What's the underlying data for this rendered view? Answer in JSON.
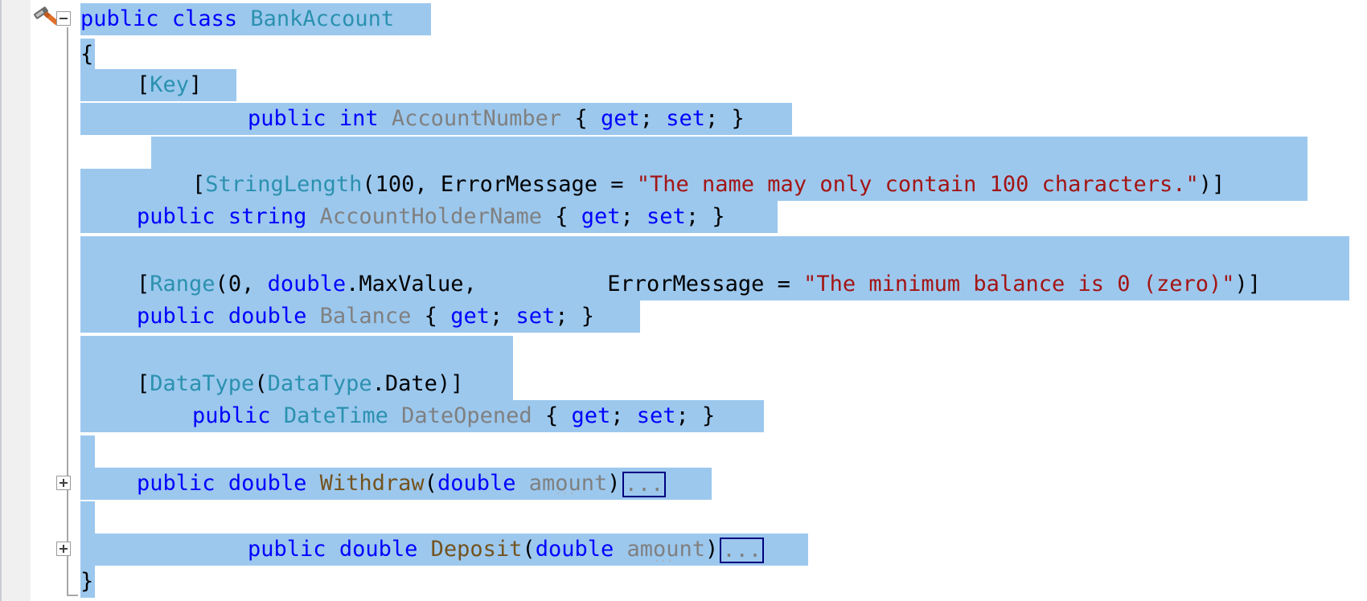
{
  "editor": {
    "lines": [
      {
        "text": "public class BankAccount"
      },
      {
        "text": "{"
      },
      {
        "attr": "Key"
      },
      {
        "prop": "AccountNumber",
        "type": "int"
      },
      {
        "blank": true
      },
      {
        "attr": "StringLength",
        "args_num": "100",
        "args_name": "ErrorMessage = ",
        "args_str": "\"The name may only contain 100 characters.\""
      },
      {
        "prop": "AccountHolderName",
        "type": "string"
      },
      {
        "blank": true
      },
      {
        "attr": "Range",
        "args_num": "0",
        "args_type": "double",
        "args_member": "MaxValue",
        "args_name": "ErrorMessage = ",
        "args_str": "\"The minimum balance is 0 (zero)\""
      },
      {
        "prop": "Balance",
        "type": "double"
      },
      {
        "blank": true
      },
      {
        "attr": "DataType",
        "args_type": "DataType",
        "args_member": "Date"
      },
      {
        "prop": "DateOpened",
        "type": "DateTime"
      },
      {
        "blank": true
      },
      {
        "method": "Withdraw",
        "ret": "double",
        "param_type": "double",
        "param": "amount",
        "collapsed": "..."
      },
      {
        "blank": true
      },
      {
        "method": "Deposit",
        "ret": "double",
        "param_type": "double",
        "param": "amount",
        "collapsed": "..."
      },
      {
        "text": "}"
      }
    ],
    "keywords": {
      "public": "public",
      "class": "class",
      "get": "get",
      "set": "set"
    },
    "colors": {
      "selection": "#9cc8ee",
      "keyword": "#0000ff",
      "type": "#2b91af",
      "string": "#a31515",
      "method": "#74531f",
      "member": "#808080"
    }
  }
}
